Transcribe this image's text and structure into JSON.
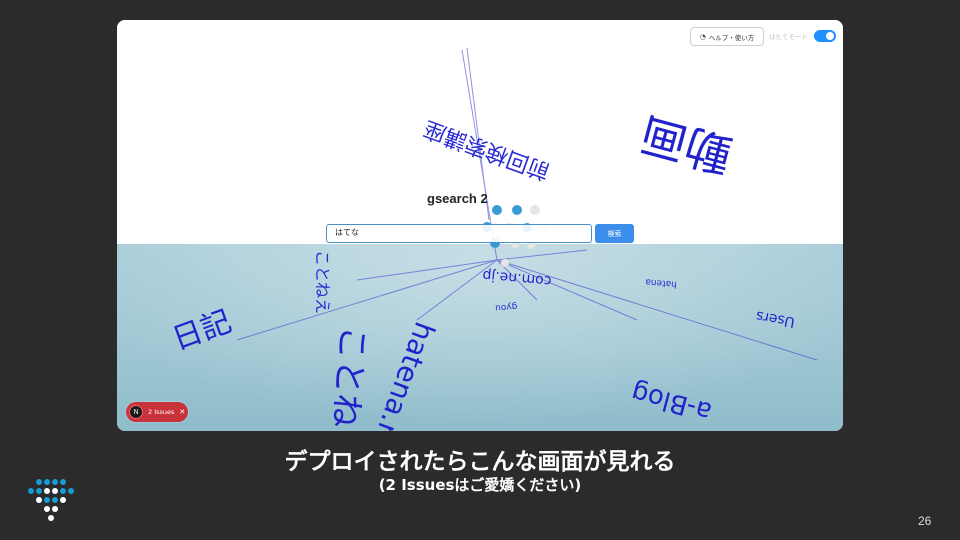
{
  "toolbar": {
    "help_label": "ヘルプ・使い方",
    "mode_label": "はたてモード",
    "mode_enabled": true
  },
  "app": {
    "title": "gsearch 2",
    "search_value": "はてな",
    "search_button": "検索"
  },
  "scene_words": {
    "giant": "動画",
    "upper_right": "前回検索講座",
    "hatena_jp": "hatena.ne.jp",
    "tsumi": "ことね",
    "nikki": "日記",
    "blog": "a-Blog",
    "com": "com.ne.jp",
    "ume": "ことねえ",
    "users": "Users",
    "sub1": "gyou",
    "sub2": "hatena"
  },
  "devtools": {
    "issues_label": "2 Issues",
    "logo_letter": "N"
  },
  "caption": {
    "main": "デプロイされたらこんな画面が見れる",
    "sub": "(2 Issuesはご愛嬌ください)"
  },
  "slide": {
    "page_number": "26"
  },
  "colors": {
    "background": "#2b2b2b",
    "accent_blue": "#3b8eea",
    "word_blue": "#2222cc",
    "badge_red": "#c8323a",
    "logo_blue": "#1a9ad6"
  }
}
